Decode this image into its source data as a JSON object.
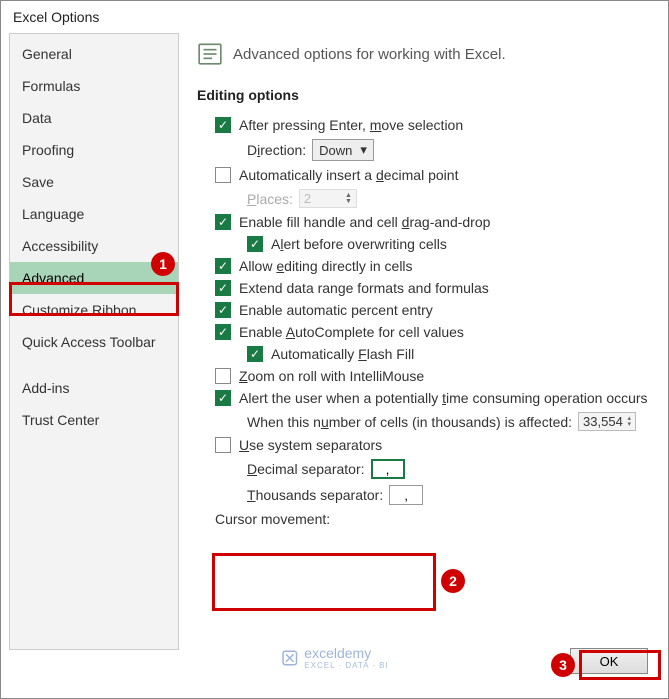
{
  "title": "Excel Options",
  "sidebar": {
    "items": [
      {
        "label": "General"
      },
      {
        "label": "Formulas"
      },
      {
        "label": "Data"
      },
      {
        "label": "Proofing"
      },
      {
        "label": "Save"
      },
      {
        "label": "Language"
      },
      {
        "label": "Accessibility"
      },
      {
        "label": "Advanced"
      },
      {
        "label": "Customize Ribbon"
      },
      {
        "label": "Quick Access Toolbar"
      },
      {
        "label": "Add-ins"
      },
      {
        "label": "Trust Center"
      }
    ]
  },
  "main": {
    "header": "Advanced options for working with Excel.",
    "section_title": "Editing options",
    "after_enter_pre": "After pressing Enter, ",
    "after_enter_m": "m",
    "after_enter_post": "ove selection",
    "direction_pre": "D",
    "direction_i": "i",
    "direction_post": "rection:",
    "direction_value": "Down",
    "auto_decimal_pre": "Automatically insert a ",
    "auto_decimal_d": "d",
    "auto_decimal_post": "ecimal point",
    "places_pre": "",
    "places_p": "P",
    "places_post": "laces:",
    "places_value": "2",
    "fill_handle_pre": "Enable fill handle and cell ",
    "fill_handle_d": "d",
    "fill_handle_post": "rag-and-drop",
    "alert_overwrite_pre": "A",
    "alert_overwrite_l": "l",
    "alert_overwrite_post": "ert before overwriting cells",
    "allow_edit_pre": "Allow ",
    "allow_edit_e": "e",
    "allow_edit_post": "diting directly in cells",
    "extend_formats": "Extend data range formats and formulas",
    "auto_percent": "Enable automatic percent entry",
    "autocomplete_pre": "Enable ",
    "autocomplete_a": "A",
    "autocomplete_post": "utoComplete for cell values",
    "flash_fill_pre": "Automatically ",
    "flash_fill_f": "F",
    "flash_fill_post": "lash Fill",
    "zoom_pre": "",
    "zoom_z": "Z",
    "zoom_post": "oom on roll with IntelliMouse",
    "alert_time_pre": "Alert the user when a potentially ",
    "alert_time_t": "t",
    "alert_time_post": "ime consuming operation occurs",
    "cells_affected_pre": "When this n",
    "cells_affected_u": "u",
    "cells_affected_post": "mber of cells (in thousands) is affected:",
    "cells_affected_value": "33,554",
    "use_separators_pre": "",
    "use_separators_u": "U",
    "use_separators_post": "se system separators",
    "decimal_sep_pre": "",
    "decimal_sep_d": "D",
    "decimal_sep_post": "ecimal separator:",
    "decimal_sep_value": ",",
    "thousands_sep_pre": "",
    "thousands_sep_t": "T",
    "thousands_sep_post": "housands separator:",
    "thousands_sep_value": ",",
    "cursor_movement": "Cursor movement:"
  },
  "buttons": {
    "ok": "OK"
  },
  "badges": {
    "one": "1",
    "two": "2",
    "three": "3"
  },
  "watermark": {
    "brand": "exceldemy",
    "tag": "EXCEL · DATA · BI"
  }
}
